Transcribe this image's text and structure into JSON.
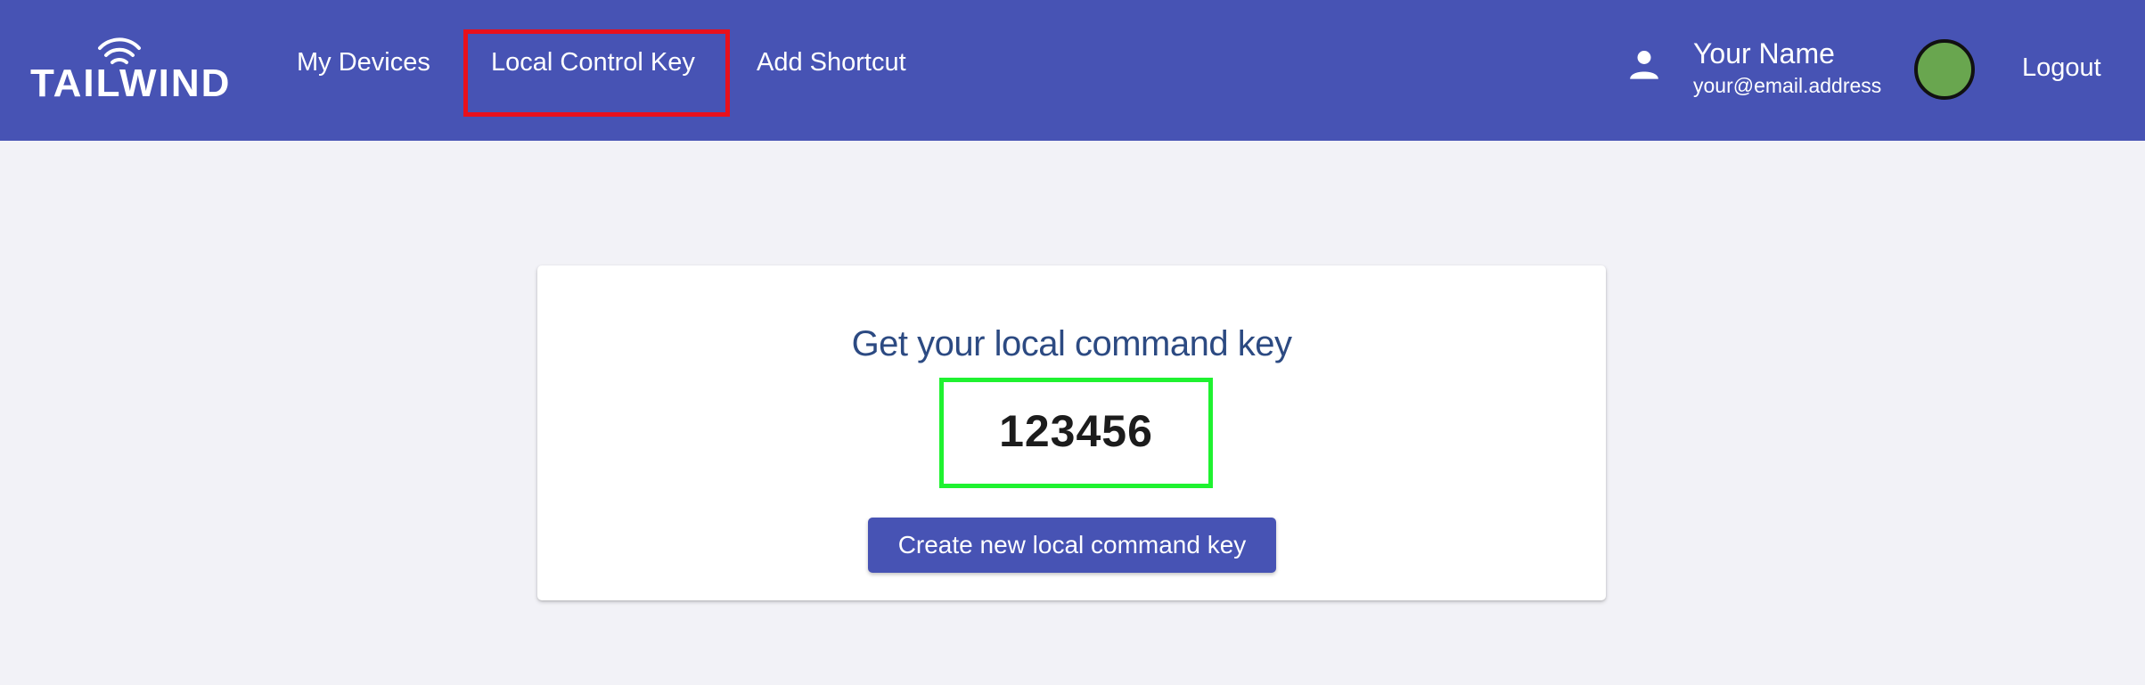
{
  "header": {
    "logo_text": "TAILWIND",
    "nav": {
      "my_devices": "My Devices",
      "local_control_key": "Local Control Key",
      "add_shortcut": "Add Shortcut"
    },
    "user": {
      "icon": "person-icon",
      "name": "Your Name",
      "email": "your@email.address"
    },
    "logout": "Logout"
  },
  "card": {
    "title": "Get your local command key",
    "key": "123456",
    "button_label": "Create new local command key"
  },
  "colors": {
    "header_bg": "#4753b4",
    "page_bg": "#f2f2f7",
    "title": "#2c4a82",
    "avatar": "#69a64f",
    "highlight_red": "#e8101c",
    "highlight_green": "#1ff230"
  }
}
